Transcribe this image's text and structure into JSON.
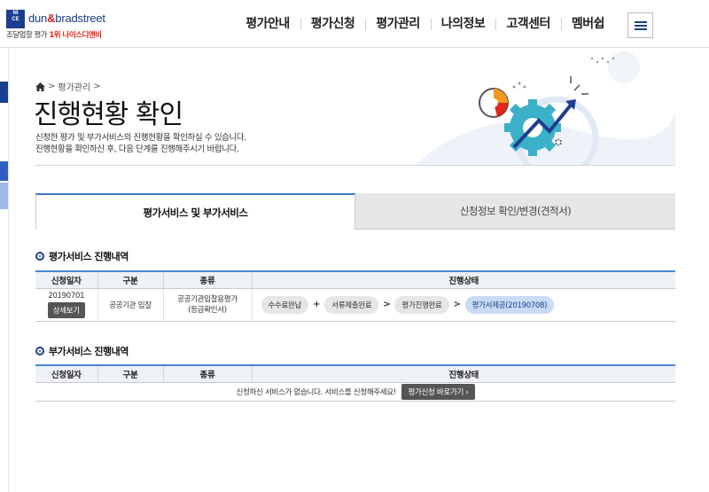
{
  "brand": {
    "logo_box_line1": "NI",
    "logo_box_line2": "CE",
    "name_part1": "dun",
    "name_amp": "&",
    "name_part2": "bradstreet",
    "tagline_part1": "조달업할 평가 ",
    "tagline_rank": "1위",
    "tagline_part2": " 나이스디앤비"
  },
  "gnb": {
    "items": [
      "평가안내",
      "평가신청",
      "평가관리",
      "나의정보",
      "고객센터",
      "멤버쉽"
    ],
    "menu_icon": "hamburger-icon"
  },
  "breadcrumb": {
    "home_icon": "home-icon",
    "sep": ">",
    "current": "평가관리"
  },
  "page": {
    "title": "진행현황 확인",
    "desc_line1": "신청한 평가 및 부가서비스의 진행현황을 확인하실 수 있습니다.",
    "desc_line2": "진행현황을 확인하신 후, 다음 단계를 진행해주시기 바랍니다."
  },
  "tabs": [
    {
      "label": "평가서비스 및 부가서비스",
      "active": true
    },
    {
      "label": "신청정보 확인/변경(견적서)",
      "active": false
    }
  ],
  "section1": {
    "title": "평가서비스 진행내역",
    "headers": [
      "신청일자",
      "구분",
      "종류",
      "진행상태"
    ],
    "row": {
      "date": "20190701",
      "detail_button": "상세보기",
      "category": "공공기관 입찰",
      "type_line1": "공공기관입찰용평가",
      "type_line2": "(등급확인서)",
      "steps": [
        "수수료완납",
        "서류제출완료",
        "평가진행완료",
        "평가서제공(20190708)"
      ],
      "step_seps": [
        "+",
        ">",
        ">"
      ]
    }
  },
  "section2": {
    "title": "부가서비스 진행내역",
    "headers": [
      "신청일자",
      "구분",
      "종류",
      "진행상태"
    ],
    "empty_message": "신청하신 서비스가 없습니다. 서비스를 신청해주세요!",
    "apply_button": "평가신청 바로가기 ›"
  },
  "colors": {
    "brand_navy": "#1b3f8f",
    "brand_red": "#e2231a",
    "accent_blue": "#3a78c9",
    "gear_teal": "#3ab0c9",
    "chart_orange": "#f39a1e"
  }
}
